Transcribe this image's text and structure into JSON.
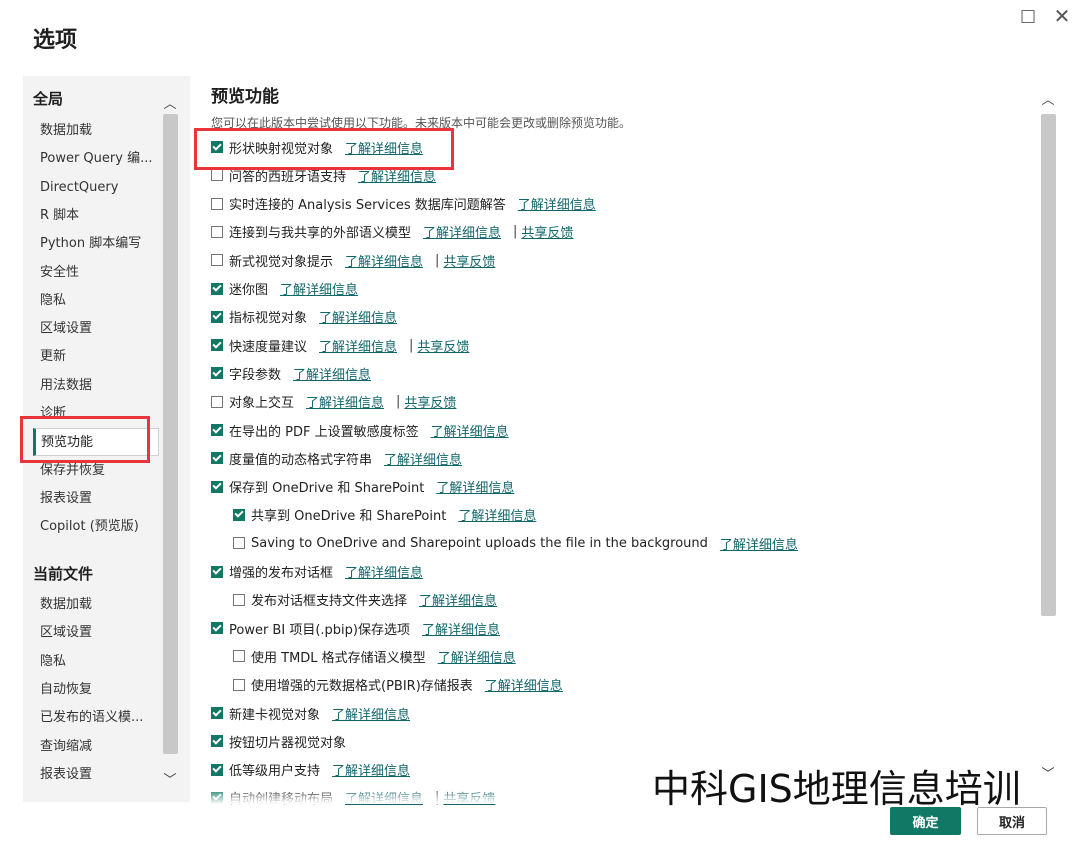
{
  "window": {
    "maximize_icon": "□",
    "close_icon": "✕"
  },
  "title": "选项",
  "sidebar": {
    "global_header": "全局",
    "global_items": [
      "数据加载",
      "Power Query 编...",
      "DirectQuery",
      "R 脚本",
      "Python 脚本编写",
      "安全性",
      "隐私",
      "区域设置",
      "更新",
      "用法数据",
      "诊断",
      "预览功能",
      "保存并恢复",
      "报表设置",
      "Copilot (预览版)"
    ],
    "selected": "预览功能",
    "file_header": "当前文件",
    "file_items": [
      "数据加载",
      "区域设置",
      "隐私",
      "自动恢复",
      "已发布的语义模...",
      "查询缩减",
      "报表设置"
    ]
  },
  "main": {
    "title": "预览功能",
    "description": "您可以在此版本中尝试使用以下功能。未来版本中可能会更改或删除预览功能。",
    "link_label": "了解详细信息",
    "feedback_label": "共享反馈",
    "options": [
      {
        "label": "形状映射视觉对象",
        "checked": true,
        "indent": 0,
        "feedback": false
      },
      {
        "label": "问答的西班牙语支持",
        "checked": false,
        "indent": 0,
        "feedback": false
      },
      {
        "label": "实时连接的 Analysis Services 数据库问题解答",
        "checked": false,
        "indent": 0,
        "feedback": false
      },
      {
        "label": "连接到与我共享的外部语义模型",
        "checked": false,
        "indent": 0,
        "feedback": true
      },
      {
        "label": "新式视觉对象提示",
        "checked": false,
        "indent": 0,
        "feedback": true
      },
      {
        "label": "迷你图",
        "checked": true,
        "indent": 0,
        "feedback": false
      },
      {
        "label": "指标视觉对象",
        "checked": true,
        "indent": 0,
        "feedback": false
      },
      {
        "label": "快速度量建议",
        "checked": true,
        "indent": 0,
        "feedback": true
      },
      {
        "label": "字段参数",
        "checked": true,
        "indent": 0,
        "feedback": false
      },
      {
        "label": "对象上交互",
        "checked": false,
        "indent": 0,
        "feedback": true
      },
      {
        "label": "在导出的 PDF 上设置敏感度标签",
        "checked": true,
        "indent": 0,
        "feedback": false
      },
      {
        "label": "度量值的动态格式字符串",
        "checked": true,
        "indent": 0,
        "feedback": false
      },
      {
        "label": "保存到 OneDrive 和 SharePoint",
        "checked": true,
        "indent": 0,
        "feedback": false
      },
      {
        "label": "共享到 OneDrive 和 SharePoint",
        "checked": true,
        "indent": 1,
        "feedback": false
      },
      {
        "label": "Saving to OneDrive and Sharepoint uploads the file in the background",
        "checked": false,
        "indent": 1,
        "feedback": false
      },
      {
        "label": "增强的发布对话框",
        "checked": true,
        "indent": 0,
        "feedback": false
      },
      {
        "label": "发布对话框支持文件夹选择",
        "checked": false,
        "indent": 1,
        "feedback": false
      },
      {
        "label": "Power BI 项目(.pbip)保存选项",
        "checked": true,
        "indent": 0,
        "feedback": false
      },
      {
        "label": "使用 TMDL 格式存储语义模型",
        "checked": false,
        "indent": 1,
        "feedback": false
      },
      {
        "label": "使用增强的元数据格式(PBIR)存储报表",
        "checked": false,
        "indent": 1,
        "feedback": false
      },
      {
        "label": "新建卡视觉对象",
        "checked": true,
        "indent": 0,
        "feedback": false
      },
      {
        "label": "按钮切片器视觉对象",
        "checked": true,
        "indent": 0,
        "feedback": false,
        "nolink": true
      },
      {
        "label": "低等级用户支持",
        "checked": true,
        "indent": 0,
        "feedback": false
      },
      {
        "label": "自动创建移动布局",
        "checked": true,
        "indent": 0,
        "feedback": true
      }
    ]
  },
  "watermark": "中科GIS地理信息培训",
  "buttons": {
    "ok": "确定",
    "cancel": "取消"
  }
}
